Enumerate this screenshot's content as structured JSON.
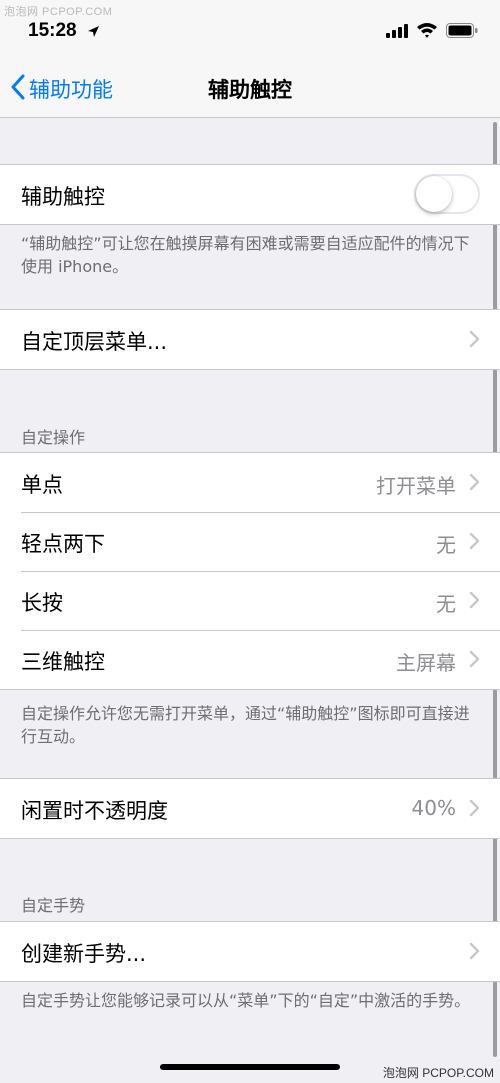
{
  "watermark_top": "泡泡网 PCPOP.COM",
  "watermark_bottom": "泡泡网 PCPOP.COM",
  "status_bar": {
    "time": "15:28",
    "icons": [
      "location-arrow-icon",
      "signal-bars-icon",
      "wifi-icon",
      "battery-icon"
    ]
  },
  "nav": {
    "back_label": "辅助功能",
    "title": "辅助触控"
  },
  "assistive_touch": {
    "label": "辅助触控",
    "toggle_on": false,
    "footnote": "“辅助触控”可让您在触摸屏幕有困难或需要自适应配件的情况下使用 iPhone。"
  },
  "customize_top_menu": {
    "label": "自定顶层菜单..."
  },
  "custom_actions": {
    "header": "自定操作",
    "rows": [
      {
        "label": "单点",
        "value": "打开菜单"
      },
      {
        "label": "轻点两下",
        "value": "无"
      },
      {
        "label": "长按",
        "value": "无"
      },
      {
        "label": "三维触控",
        "value": "主屏幕"
      }
    ],
    "footnote": "自定操作允许您无需打开菜单，通过“辅助触控”图标即可直接进行互动。"
  },
  "idle_opacity": {
    "label": "闲置时不透明度",
    "value": "40%"
  },
  "custom_gestures": {
    "header": "自定手势",
    "create_label": "创建新手势...",
    "footnote": "自定手势让您能够记录可以从“菜单”下的“自定”中激活的手势。"
  },
  "colors": {
    "accent": "#007aff",
    "background": "#efeff4",
    "secondary_text": "#8e8e93"
  }
}
